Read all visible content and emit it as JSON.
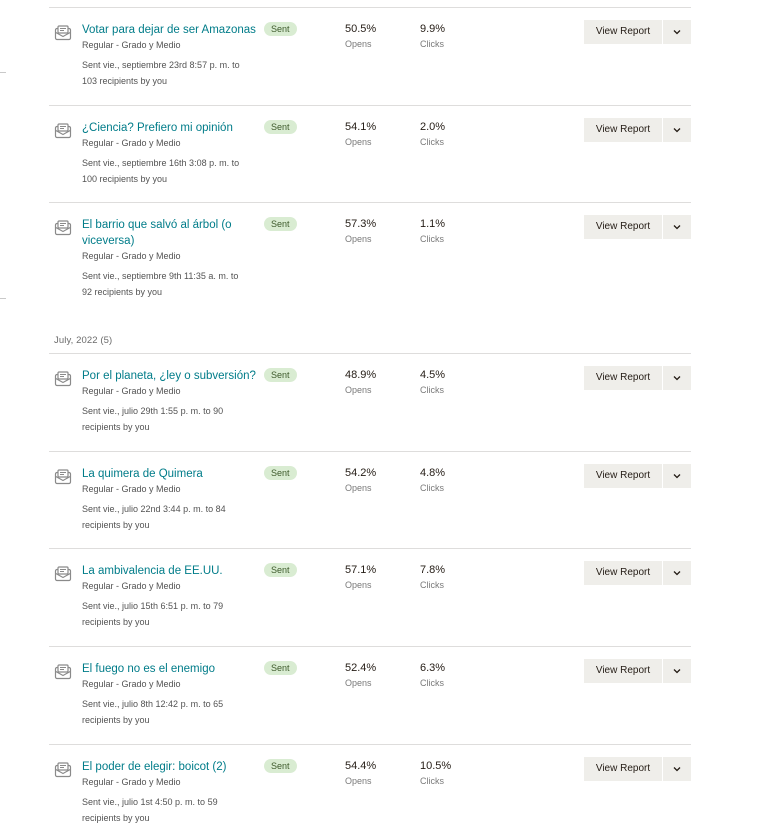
{
  "list": {
    "items": [
      {
        "title": "Votar para dejar de ser Amazonas",
        "subtitle": "Regular - Grado y Medio",
        "status": "Sent",
        "sent_line1": "Sent vie., septiembre 23rd 8:57 p. m. to",
        "sent_line2": "103 recipients by you",
        "opens": "50.5%",
        "opens_label": "Opens",
        "clicks": "9.9%",
        "clicks_label": "Clicks",
        "button": "View Report"
      },
      {
        "title": "¿Ciencia? Prefiero mi opinión",
        "subtitle": "Regular - Grado y Medio",
        "status": "Sent",
        "sent_line1": "Sent vie., septiembre 16th 3:08 p. m. to",
        "sent_line2": "100 recipients by you",
        "opens": "54.1%",
        "opens_label": "Opens",
        "clicks": "2.0%",
        "clicks_label": "Clicks",
        "button": "View Report"
      },
      {
        "title_line1": "El barrio que salvó al árbol (o",
        "title_line2": "viceversa)",
        "subtitle": "Regular - Grado y Medio",
        "status": "Sent",
        "sent_line1": "Sent vie., septiembre 9th 11:35 a. m. to",
        "sent_line2": "92 recipients by you",
        "opens": "57.3%",
        "opens_label": "Opens",
        "clicks": "1.1%",
        "clicks_label": "Clicks",
        "button": "View Report"
      },
      {
        "title": "Por el planeta, ¿ley o subversión?",
        "subtitle": "Regular - Grado y Medio",
        "status": "Sent",
        "sent_line1": "Sent vie., julio 29th 1:55 p. m. to 90",
        "sent_line2": "recipients by you",
        "opens": "48.9%",
        "opens_label": "Opens",
        "clicks": "4.5%",
        "clicks_label": "Clicks",
        "button": "View Report"
      },
      {
        "title": "La quimera de Quimera",
        "subtitle": "Regular - Grado y Medio",
        "status": "Sent",
        "sent_line1": "Sent vie., julio 22nd 3:44 p. m. to 84",
        "sent_line2": "recipients by you",
        "opens": "54.2%",
        "opens_label": "Opens",
        "clicks": "4.8%",
        "clicks_label": "Clicks",
        "button": "View Report"
      },
      {
        "title": "La ambivalencia de EE.UU.",
        "subtitle": "Regular - Grado y Medio",
        "status": "Sent",
        "sent_line1": "Sent vie., julio 15th 6:51 p. m. to 79",
        "sent_line2": "recipients by you",
        "opens": "57.1%",
        "opens_label": "Opens",
        "clicks": "7.8%",
        "clicks_label": "Clicks",
        "button": "View Report"
      },
      {
        "title": "El fuego no es el enemigo",
        "subtitle": "Regular - Grado y Medio",
        "status": "Sent",
        "sent_line1": "Sent vie., julio 8th 12:42 p. m. to 65",
        "sent_line2": "recipients by you",
        "opens": "52.4%",
        "opens_label": "Opens",
        "clicks": "6.3%",
        "clicks_label": "Clicks",
        "button": "View Report"
      },
      {
        "title": "El poder de elegir: boicot (2)",
        "subtitle": "Regular - Grado y Medio",
        "status": "Sent",
        "sent_line1": "Sent vie., julio 1st 4:50 p. m. to 59",
        "sent_line2": "recipients by you",
        "opens": "54.4%",
        "opens_label": "Opens",
        "clicks": "10.5%",
        "clicks_label": "Clicks",
        "button": "View Report"
      }
    ]
  },
  "groups": {
    "july_heading": "July, 2022 (5)"
  },
  "icons": {
    "row_icon": "email-campaign-icon",
    "menu_icon": "chevron-down-icon"
  },
  "colors": {
    "link": "#007c89",
    "badge_bg": "#d9ecd2",
    "button_bg": "#efeeea"
  }
}
